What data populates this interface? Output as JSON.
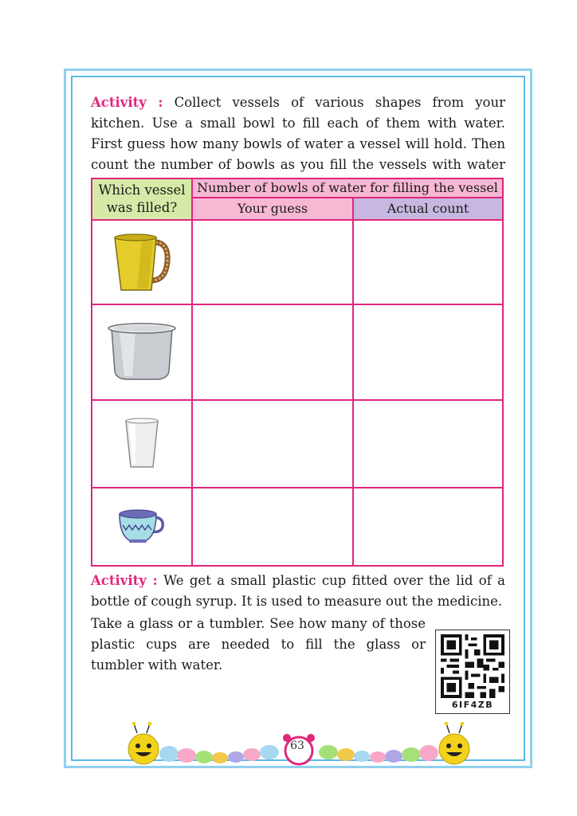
{
  "activity1": {
    "label": "Activity :",
    "text": " Collect vessels of various shapes from your kitchen. Use a small bowl to fill each of them with water. First guess how many bowls of water a vessel will hold. Then count the number of bowls as you fill the vessels with water and verify your guess."
  },
  "table": {
    "col1_header": "Which vessel was filled?",
    "group_header": "Number of bowls of water for filling the vessel",
    "col2_header": "Your guess",
    "col3_header": "Actual count"
  },
  "activity2": {
    "label": "Activity :",
    "text": " We get a small plastic cup fitted over the lid of a bottle of cough syrup. It is used to measure out the medicine."
  },
  "paragraph3": "Take a glass or a tumbler. See how many of those plastic cups are needed to fill the glass or tumbler with water.",
  "qr_code": "6IF4ZB",
  "page_number": "63",
  "colors": {
    "accent": "#e0267d",
    "header_green": "#d6eaa8",
    "header_pink": "#f7b8d4",
    "header_purple": "#c6b8e0",
    "border_blue": "#5ab9e6"
  }
}
